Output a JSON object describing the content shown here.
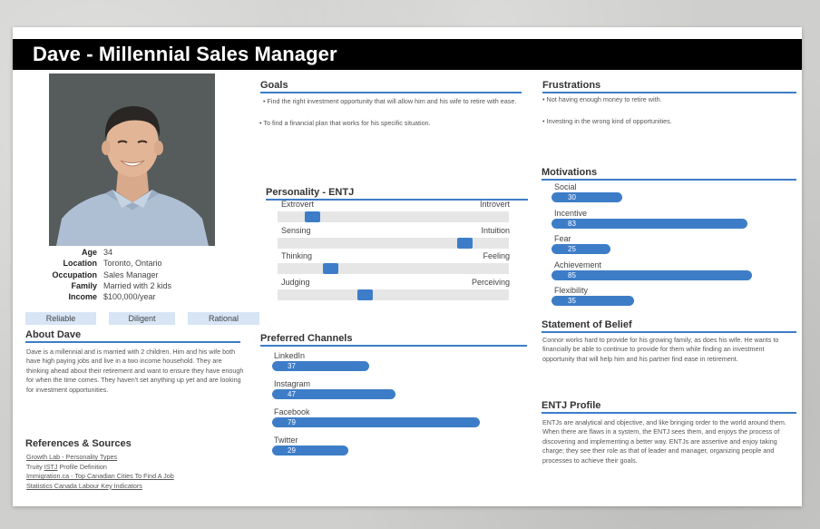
{
  "persona": {
    "title": "Dave - Millennial Sales Manager",
    "profile": [
      {
        "key": "Age",
        "value": "34"
      },
      {
        "key": "Location",
        "value": "Toronto, Ontario"
      },
      {
        "key": "Occupation",
        "value": "Sales Manager"
      },
      {
        "key": "Family",
        "value": "Married with 2 kids"
      },
      {
        "key": "Income",
        "value": "$100,000/year"
      }
    ],
    "traits": [
      "Reliable",
      "Diligent",
      "Rational"
    ]
  },
  "about": {
    "heading": "About Dave",
    "text": "Dave is a millennial and is married with 2 children. Him and his wife both have high paying jobs and live in a two income household. They are thinking ahead about their retirement and want to ensure they have enough for when the time comes. They haven't set anything up yet and are looking for investment opportunities."
  },
  "references": {
    "heading": "References & Sources",
    "items": [
      {
        "pre": "",
        "link": "Growth Lab - Personality Types",
        "post": ""
      },
      {
        "pre": "Truity ",
        "link": "ISTJ",
        "post": " Profile Definition"
      },
      {
        "pre": "",
        "link": "Immigration.ca - Top Canadian Cities To Find A Job",
        "post": ""
      },
      {
        "pre": "",
        "link": "Statistics Canada Labour Key Indicators",
        "post": ""
      }
    ]
  },
  "goals": {
    "heading": "Goals",
    "items": [
      "• Find the right investment opportunity that will allow him and his wife to retire with ease.",
      "• To find a financial plan that works for his specific situation."
    ]
  },
  "personality": {
    "heading": "Personality - ENTJ",
    "scales": [
      {
        "left": "Extrovert",
        "right": "Introvert",
        "position": 0.15
      },
      {
        "left": "Sensing",
        "right": "Intuition",
        "position": 0.81
      },
      {
        "left": "Thinking",
        "right": "Feeling",
        "position": 0.23
      },
      {
        "left": "Judging",
        "right": "Perceiving",
        "position": 0.38
      }
    ]
  },
  "channels": {
    "heading": "Preferred Channels",
    "items": [
      {
        "label": "LinkedIn",
        "value": "37",
        "percent": 37
      },
      {
        "label": "Instagram",
        "value": "47",
        "percent": 47
      },
      {
        "label": "Facebook",
        "value": "79",
        "percent": 79
      },
      {
        "label": "Twitter",
        "value": "29",
        "percent": 29
      }
    ]
  },
  "frustrations": {
    "heading": "Frustrations",
    "items": [
      "• Not having enough money to retire with.",
      "• Investing in the wrong kind of opportunities."
    ]
  },
  "motivations": {
    "heading": "Motivations",
    "items": [
      {
        "label": "Social",
        "value": "30",
        "percent": 30
      },
      {
        "label": "Incentive",
        "value": "83",
        "percent": 83
      },
      {
        "label": "Fear",
        "value": "25",
        "percent": 25
      },
      {
        "label": "Achievement",
        "value": "85",
        "percent": 85
      },
      {
        "label": "Flexibility",
        "value": "35",
        "percent": 35
      }
    ]
  },
  "belief": {
    "heading": "Statement of Belief",
    "text": "Connor works hard to provide for his growing family, as does his wife. He wants to financially be able to continue to provide for them while finding an investment opportunity that will help him and his partner find ease in retirement."
  },
  "entj": {
    "heading": "ENTJ Profile",
    "text": "ENTJs are analytical and objective, and like bringing order to the world around them. When there are flaws in a system, the ENTJ sees them, and enjoys the process of discovering and implementing a better way. ENTJs are assertive and enjoy taking charge; they see their role as that of leader and manager, organizing people and processes to achieve their goals."
  },
  "colors": {
    "accent": "#3d7dc8",
    "trait_bg": "#d7e5f5",
    "title_bg": "#000000"
  }
}
